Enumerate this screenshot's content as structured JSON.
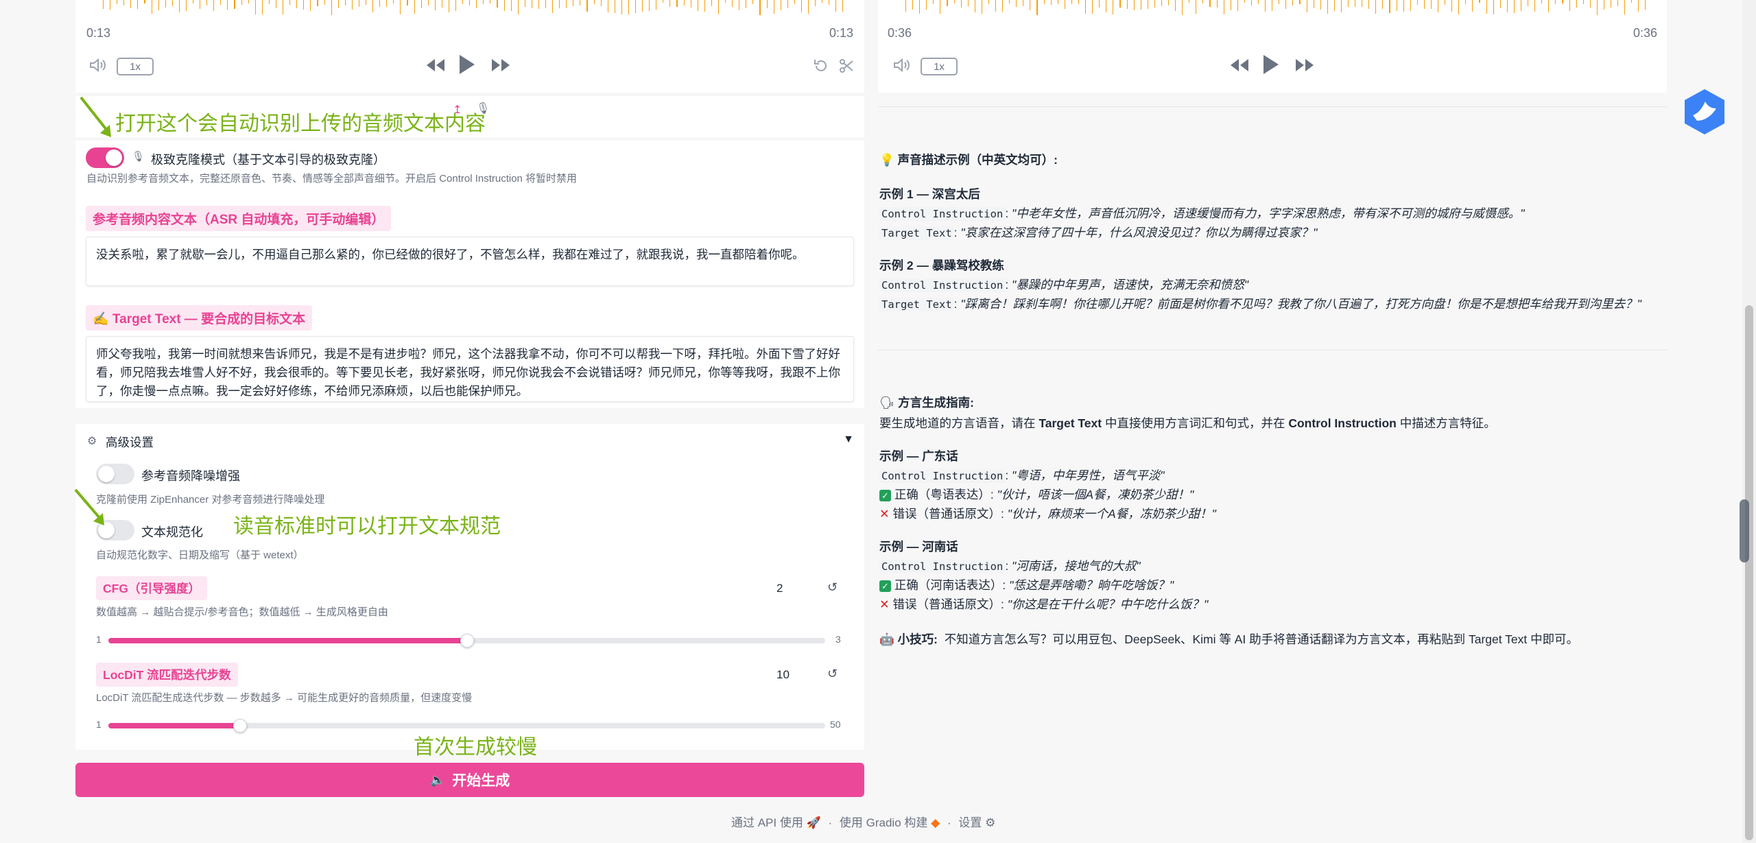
{
  "left_player": {
    "time_start": "0:13",
    "time_end": "0:13",
    "rate": "1x"
  },
  "right_player": {
    "time_start": "0:36",
    "time_end": "0:36",
    "rate": "1x"
  },
  "annotations": {
    "asr_note": "打开这个会自动识别上传的音频文本内容",
    "normalize_note": "读音标准时可以打开文本规范",
    "slow_note": "首次生成较慢"
  },
  "clone_mode": {
    "label": "极致克隆模式（基于文本引导的极致克隆）",
    "hint": "自动识别参考音频文本，完整还原音色、节奏、情感等全部声音细节。开启后 Control Instruction 将暂时禁用",
    "enabled": true
  },
  "reference_text": {
    "label": "参考音频内容文本（ASR 自动填充，可手动编辑）",
    "value": "没关系啦，累了就歇一会儿，不用逼自己那么紧的，你已经做的很好了，不管怎么样，我都在难过了，就跟我说，我一直都陪着你呢。"
  },
  "target_text": {
    "label": "✍️ Target Text — 要合成的目标文本",
    "value": "师父夸我啦，我第一时间就想来告诉师兄，我是不是有进步啦？师兄，这个法器我拿不动，你可不可以帮我一下呀，拜托啦。外面下雪了好好看，师兄陪我去堆雪人好不好，我会很乖的。等下要见长老，我好紧张呀，师兄你说我会不会说错话呀？师兄师兄，你等等我呀，我跟不上你了，你走慢一点点嘛。我一定会好好修练，不给师兄添麻烦，以后也能保护师兄。"
  },
  "advanced": {
    "title": "高级设置",
    "collapse_glyph": "▼",
    "denoise": {
      "label": "参考音频降噪增强",
      "hint": "克隆前使用 ZipEnhancer 对参考音频进行降噪处理",
      "enabled": false
    },
    "normalize": {
      "label": "文本规范化",
      "hint": "自动规范化数字、日期及缩写（基于 wetext）",
      "enabled": false
    },
    "cfg": {
      "label": "CFG（引导强度）",
      "hint": "数值越高 → 越贴合提示/参考音色；数值越低 → 生成风格更自由",
      "value": "2",
      "min": "1",
      "max": "3",
      "fraction": 0.5
    },
    "steps": {
      "label": "LocDiT 流匹配迭代步数",
      "hint": "LocDiT 流匹配生成迭代步数 — 步数越多 → 可能生成更好的音频质量，但速度变慢",
      "value": "10",
      "min": "1",
      "max": "50",
      "fraction": 0.184
    }
  },
  "generate_button": "开始生成",
  "voice_examples": {
    "heading": "声音描述示例（中英文均可）:",
    "ex1_title": "示例 1 — 深宫太后",
    "ex1_ci_key": "Control Instruction",
    "ex1_ci_val": "\"中老年女性，声音低沉阴冷，语速缓慢而有力，字字深思熟虑，带有深不可测的城府与威慑感。\"",
    "ex1_tt_key": "Target Text",
    "ex1_tt_val": "\"哀家在这深宫待了四十年，什么风浪没见过？你以为瞒得过哀家？\"",
    "ex2_title": "示例 2 — 暴躁驾校教练",
    "ex2_ci_key": "Control Instruction",
    "ex2_ci_val": "\"暴躁的中年男声，语速快，充满无奈和愤怒\"",
    "ex2_tt_key": "Target Text",
    "ex2_tt_val": "\"踩离合！踩刹车啊！你往哪儿开呢？前面是树你看不见吗？我教了你八百遍了，打死方向盘！你是不是想把车给我开到沟里去？\""
  },
  "dialect_guide": {
    "heading": "方言生成指南:",
    "intro_a": "要生成地道的方言语音，请在 ",
    "intro_b": "Target Text",
    "intro_c": " 中直接使用方言词汇和句式，并在 ",
    "intro_d": "Control Instruction",
    "intro_e": " 中描述方言特征。",
    "cantonese_title": "示例 — 广东话",
    "cantonese_ci_key": "Control Instruction",
    "cantonese_ci_val": "\"粤语，中年男性，语气平淡\"",
    "cantonese_right_key": "正确（粤语表达）:",
    "cantonese_right_val": "\"伙计，唔该一個A餐，凍奶茶少甜！\"",
    "cantonese_wrong_key": "错误（普通话原文）:",
    "cantonese_wrong_val": "\"伙计，麻烦来一个A餐，冻奶茶少甜！\"",
    "henan_title": "示例 — 河南话",
    "henan_ci_key": "Control Instruction",
    "henan_ci_val": "\"河南话，接地气的大叔\"",
    "henan_right_key": "正确（河南话表达）:",
    "henan_right_val": "\"恁这是弄啥嘞？晌午吃啥饭？\"",
    "henan_wrong_key": "错误（普通话原文）:",
    "henan_wrong_val": "\"你这是在干什么呢？中午吃什么饭？\"",
    "tip_label": "小技巧:",
    "tip_text": "不知道方言怎么写？可以用豆包、DeepSeek、Kimi 等 AI 助手将普通话翻译为方言文本，再粘贴到 Target Text 中即可。"
  },
  "footer": {
    "api": "通过 API 使用",
    "gradio": "使用 Gradio 构建",
    "settings": "设置",
    "sep": "·"
  },
  "colors": {
    "accent": "#e84393",
    "button": "#ec4899",
    "waveform": "#f59e0b",
    "annotation": "#7ab317"
  }
}
